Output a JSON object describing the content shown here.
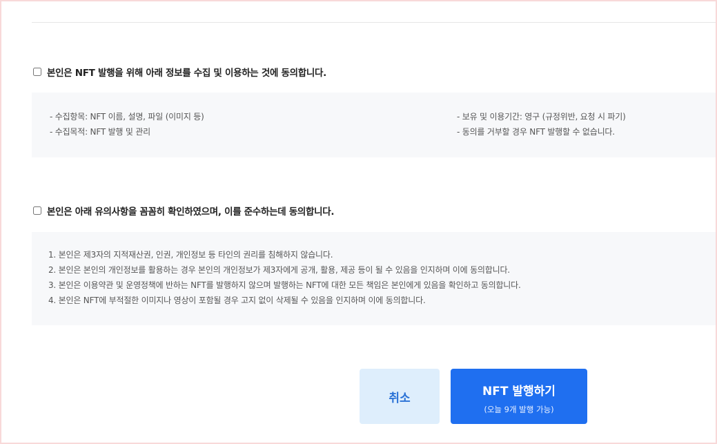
{
  "consent_privacy": {
    "label": "본인은 NFT 발행을 위해 아래 정보를 수집 및 이용하는 것에 동의합니다.",
    "checked": false,
    "details_left": [
      "- 수집항목: NFT 이름, 설명, 파일 (이미지 등)",
      "- 수집목적: NFT 발행 및 관리"
    ],
    "details_right": [
      "- 보유 및 이용기간: 영구 (규정위반, 요청 시 파기)",
      "- 동의를 거부할 경우 NFT 발행할 수 없습니다."
    ]
  },
  "consent_notice": {
    "label": "본인은 아래 유의사항을 꼼꼼히 확인하였으며, 이를 준수하는데 동의합니다.",
    "checked": false,
    "items": [
      "1. 본인은 제3자의 지적재산권, 인권, 개인정보 등 타인의 권리를 침해하지 않습니다.",
      "2. 본인은 본인의 개인정보를 활용하는 경우 본인의 개인정보가 제3자에게 공개, 활용, 제공 등이 될 수 있음을 인지하며 이에 동의합니다.",
      "3. 본인은 이용약관 및 운영정책에 반하는 NFT를 발행하지 않으며 발행하는 NFT에 대한 모든 책임은 본인에게 있음을 확인하고 동의합니다.",
      "4. 본인은 NFT에 부적절한 이미지나 영상이 포함될 경우 고지 없이 삭제될 수 있음을 인지하며 이에 동의합니다."
    ]
  },
  "buttons": {
    "cancel_label": "취소",
    "mint_label": "NFT 발행하기",
    "mint_sublabel": "(오늘 9개 발행 가능)"
  },
  "colors": {
    "primary": "#1f6ff0",
    "cancel_bg": "#deeefc",
    "cancel_text": "#2a72d6",
    "box_bg": "#f7f8fa"
  }
}
